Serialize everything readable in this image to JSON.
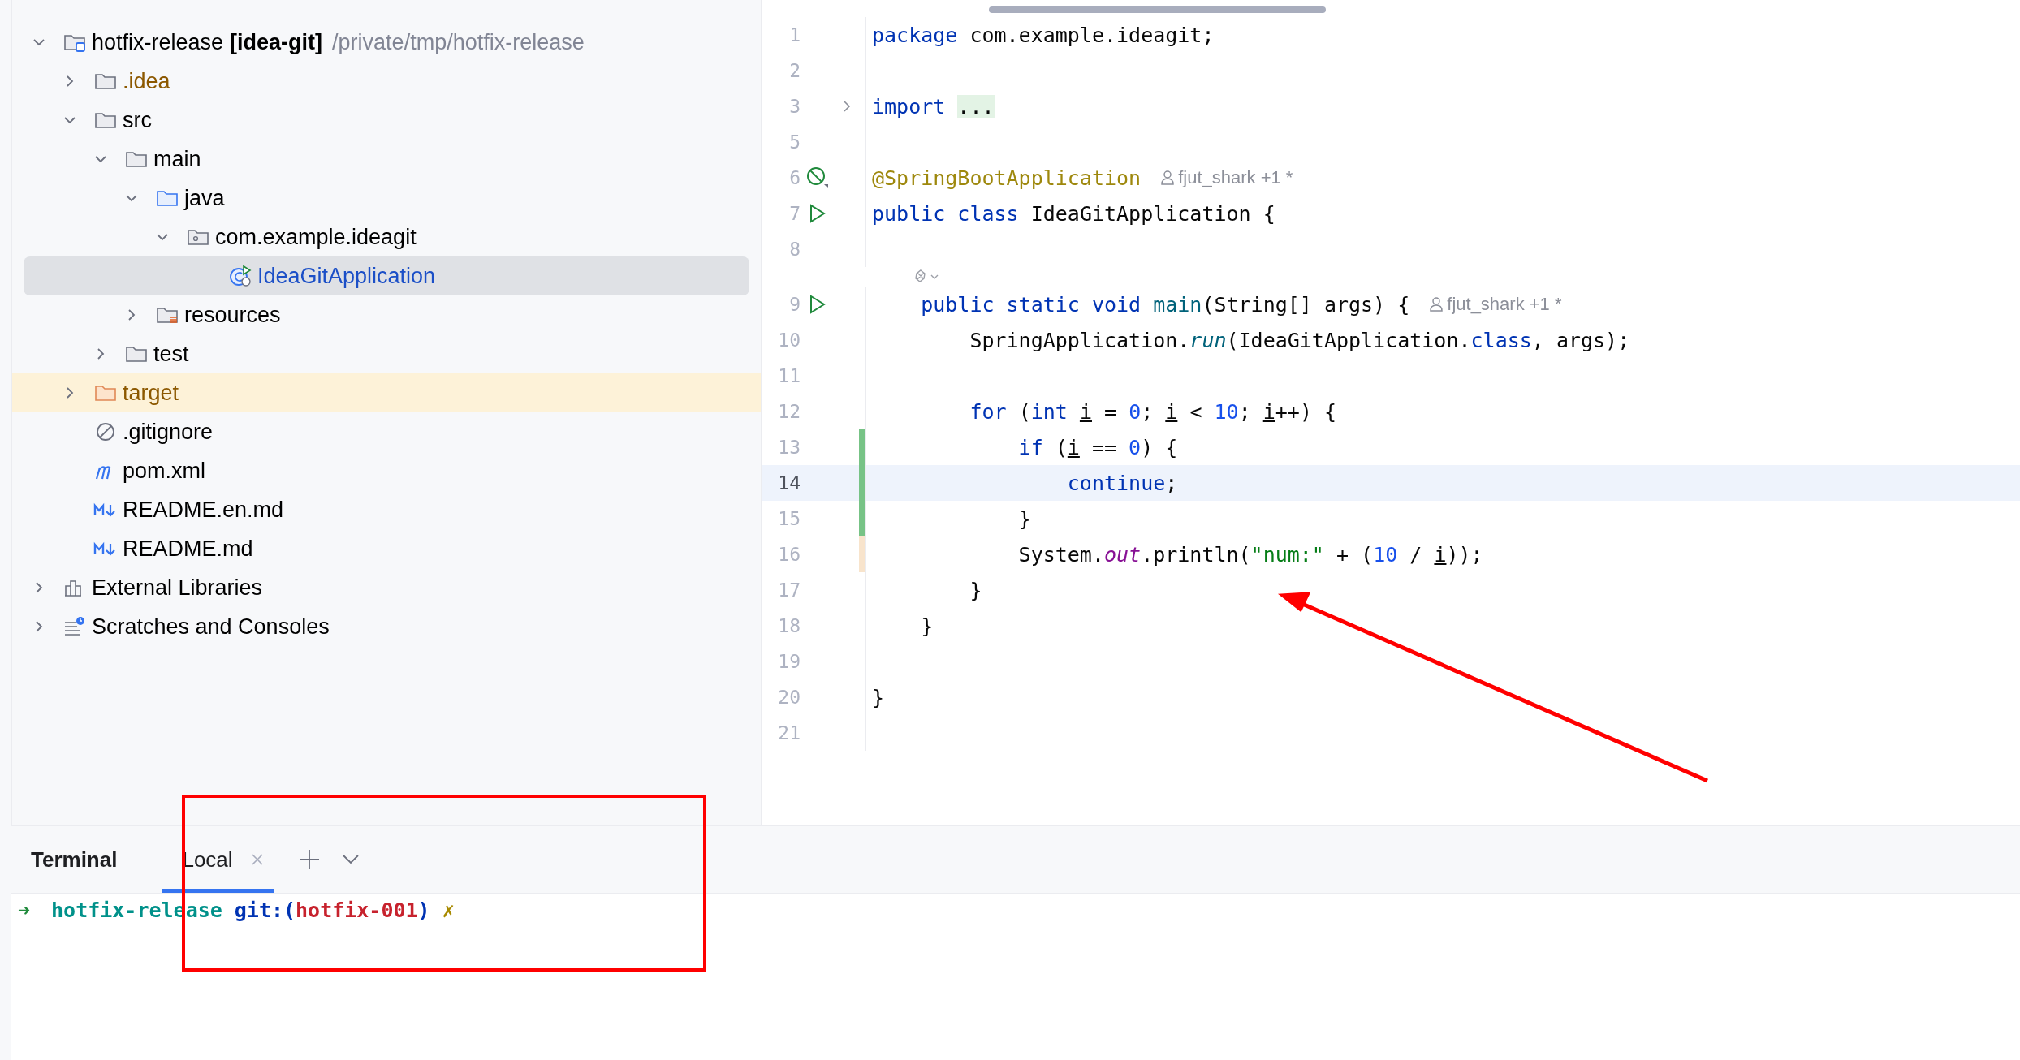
{
  "project_tree": [
    {
      "label": "hotfix-release",
      "module": "[idea-git]",
      "path": "/private/tmp/hotfix-release",
      "kind": "project",
      "expanded": true,
      "selected": false,
      "children": [
        {
          "label": ".idea",
          "kind": "folder",
          "color": "#8c5800",
          "expanded": false,
          "selected": false
        },
        {
          "label": "src",
          "kind": "folder",
          "expanded": true,
          "selected": false,
          "children": [
            {
              "label": "main",
              "kind": "folder",
              "expanded": true,
              "selected": false,
              "children": [
                {
                  "label": "java",
                  "kind": "source-folder",
                  "expanded": true,
                  "selected": false,
                  "children": [
                    {
                      "label": "com.example.ideagit",
                      "kind": "package",
                      "expanded": true,
                      "selected": false,
                      "children": [
                        {
                          "label": "IdeaGitApplication",
                          "kind": "class",
                          "color": "#1b4fc7",
                          "selected": true
                        }
                      ]
                    }
                  ]
                },
                {
                  "label": "resources",
                  "kind": "resources-folder",
                  "expanded": false,
                  "selected": false
                }
              ]
            },
            {
              "label": "test",
              "kind": "folder",
              "expanded": false,
              "selected": false
            }
          ]
        },
        {
          "label": "target",
          "kind": "excluded-folder",
          "color": "#8c5800",
          "expanded": false,
          "selected": false
        },
        {
          "label": ".gitignore",
          "kind": "ignore-file",
          "selected": false
        },
        {
          "label": "pom.xml",
          "kind": "maven-file",
          "selected": false
        },
        {
          "label": "README.en.md",
          "kind": "markdown-file",
          "selected": false
        },
        {
          "label": "README.md",
          "kind": "markdown-file",
          "selected": false
        }
      ]
    },
    {
      "label": "External Libraries",
      "kind": "libraries",
      "expanded": false,
      "selected": false
    },
    {
      "label": "Scratches and Consoles",
      "kind": "scratches",
      "expanded": false,
      "selected": false
    }
  ],
  "editor": {
    "lines": [
      {
        "kind": "code",
        "number": "1",
        "current": false,
        "tokens": [
          {
            "kind": "keyword",
            "text": "package"
          },
          {
            "kind": "plain",
            "text": " com.example.ideagit;"
          }
        ]
      },
      {
        "kind": "code",
        "number": "2",
        "current": false
      },
      {
        "kind": "code",
        "number": "3",
        "current": false,
        "gutter": {
          "kind": "fold"
        },
        "tokens": [
          {
            "kind": "keyword",
            "text": "import "
          },
          {
            "kind": "folded",
            "text": "..."
          }
        ]
      },
      {
        "kind": "code",
        "number": "5",
        "current": false
      },
      {
        "kind": "code",
        "number": "6",
        "current": false,
        "gutter": {
          "kind": "no-bean"
        },
        "hint": "fjut_shark +1 *",
        "tokens": [
          {
            "kind": "annotation",
            "text": "@SpringBootApplication"
          }
        ]
      },
      {
        "kind": "code",
        "number": "7",
        "current": false,
        "gutter": {
          "kind": "run"
        },
        "tokens": [
          {
            "kind": "keyword",
            "text": "public class"
          },
          {
            "kind": "plain",
            "text": " IdeaGitApplication {"
          }
        ]
      },
      {
        "kind": "code",
        "number": "8",
        "current": false
      },
      {
        "kind": "ai-hint"
      },
      {
        "kind": "code",
        "number": "9",
        "current": false,
        "gutter": {
          "kind": "run"
        },
        "hint": "fjut_shark +1 *",
        "tokens": [
          {
            "kind": "keyword",
            "text": "    public static void "
          },
          {
            "kind": "method",
            "text": "main"
          },
          {
            "kind": "plain",
            "text": "(String[] args) {"
          }
        ]
      },
      {
        "kind": "code",
        "number": "10",
        "current": false,
        "tokens": [
          {
            "kind": "plain",
            "text": "        SpringApplication."
          },
          {
            "kind": "static-method",
            "text": "run"
          },
          {
            "kind": "plain",
            "text": "(IdeaGitApplication."
          },
          {
            "kind": "keyword",
            "text": "class"
          },
          {
            "kind": "plain",
            "text": ", args);"
          }
        ]
      },
      {
        "kind": "code",
        "number": "11",
        "current": false
      },
      {
        "kind": "code",
        "number": "12",
        "current": false,
        "tokens": [
          {
            "kind": "keyword",
            "text": "        for"
          },
          {
            "kind": "plain",
            "text": " ("
          },
          {
            "kind": "keyword",
            "text": "int "
          },
          {
            "kind": "variable",
            "text": "i"
          },
          {
            "kind": "plain",
            "text": " = "
          },
          {
            "kind": "number",
            "text": "0"
          },
          {
            "kind": "plain",
            "text": "; "
          },
          {
            "kind": "variable",
            "text": "i"
          },
          {
            "kind": "plain",
            "text": " < "
          },
          {
            "kind": "number",
            "text": "10"
          },
          {
            "kind": "plain",
            "text": "; "
          },
          {
            "kind": "variable",
            "text": "i"
          },
          {
            "kind": "plain",
            "text": "++) {"
          }
        ]
      },
      {
        "kind": "code",
        "number": "13",
        "current": false,
        "change": {
          "kind": "added"
        },
        "tokens": [
          {
            "kind": "keyword",
            "text": "            if"
          },
          {
            "kind": "plain",
            "text": " ("
          },
          {
            "kind": "variable",
            "text": "i"
          },
          {
            "kind": "plain",
            "text": " == "
          },
          {
            "kind": "number",
            "text": "0"
          },
          {
            "kind": "plain",
            "text": ") {"
          }
        ]
      },
      {
        "kind": "code",
        "number": "14",
        "current": true,
        "change": {
          "kind": "added"
        },
        "tokens": [
          {
            "kind": "keyword",
            "text": "                continue"
          },
          {
            "kind": "plain",
            "text": ";"
          }
        ]
      },
      {
        "kind": "code",
        "number": "15",
        "current": false,
        "change": {
          "kind": "added"
        },
        "tokens": [
          {
            "kind": "plain",
            "text": "            }"
          }
        ]
      },
      {
        "kind": "code",
        "number": "16",
        "current": false,
        "change": {
          "kind": "modified"
        },
        "tokens": [
          {
            "kind": "plain",
            "text": "            System."
          },
          {
            "kind": "field",
            "text": "out"
          },
          {
            "kind": "plain",
            "text": ".println("
          },
          {
            "kind": "string",
            "text": "\"num:\""
          },
          {
            "kind": "plain",
            "text": " + ("
          },
          {
            "kind": "number",
            "text": "10"
          },
          {
            "kind": "plain",
            "text": " / "
          },
          {
            "kind": "variable",
            "text": "i"
          },
          {
            "kind": "plain",
            "text": "));"
          }
        ]
      },
      {
        "kind": "code",
        "number": "17",
        "current": false,
        "tokens": [
          {
            "kind": "plain",
            "text": "        }"
          }
        ]
      },
      {
        "kind": "code",
        "number": "18",
        "current": false,
        "tokens": [
          {
            "kind": "plain",
            "text": "    }"
          }
        ]
      },
      {
        "kind": "code",
        "number": "19",
        "current": false
      },
      {
        "kind": "code",
        "number": "20",
        "current": false,
        "tokens": [
          {
            "kind": "plain",
            "text": "}"
          }
        ]
      },
      {
        "kind": "code",
        "number": "21",
        "current": false
      }
    ]
  },
  "terminal": {
    "title": "Terminal",
    "tabs": [
      {
        "label": "Local",
        "selected": true
      }
    ],
    "prompt": [
      {
        "kind": "arrow",
        "text": "➜"
      },
      {
        "kind": "directory",
        "text": "hotfix-release"
      },
      {
        "kind": "git",
        "text": "git:("
      },
      {
        "kind": "branch",
        "text": "hotfix-001"
      },
      {
        "kind": "git",
        "text": ")"
      },
      {
        "kind": "dirty",
        "text": "✗"
      }
    ]
  }
}
